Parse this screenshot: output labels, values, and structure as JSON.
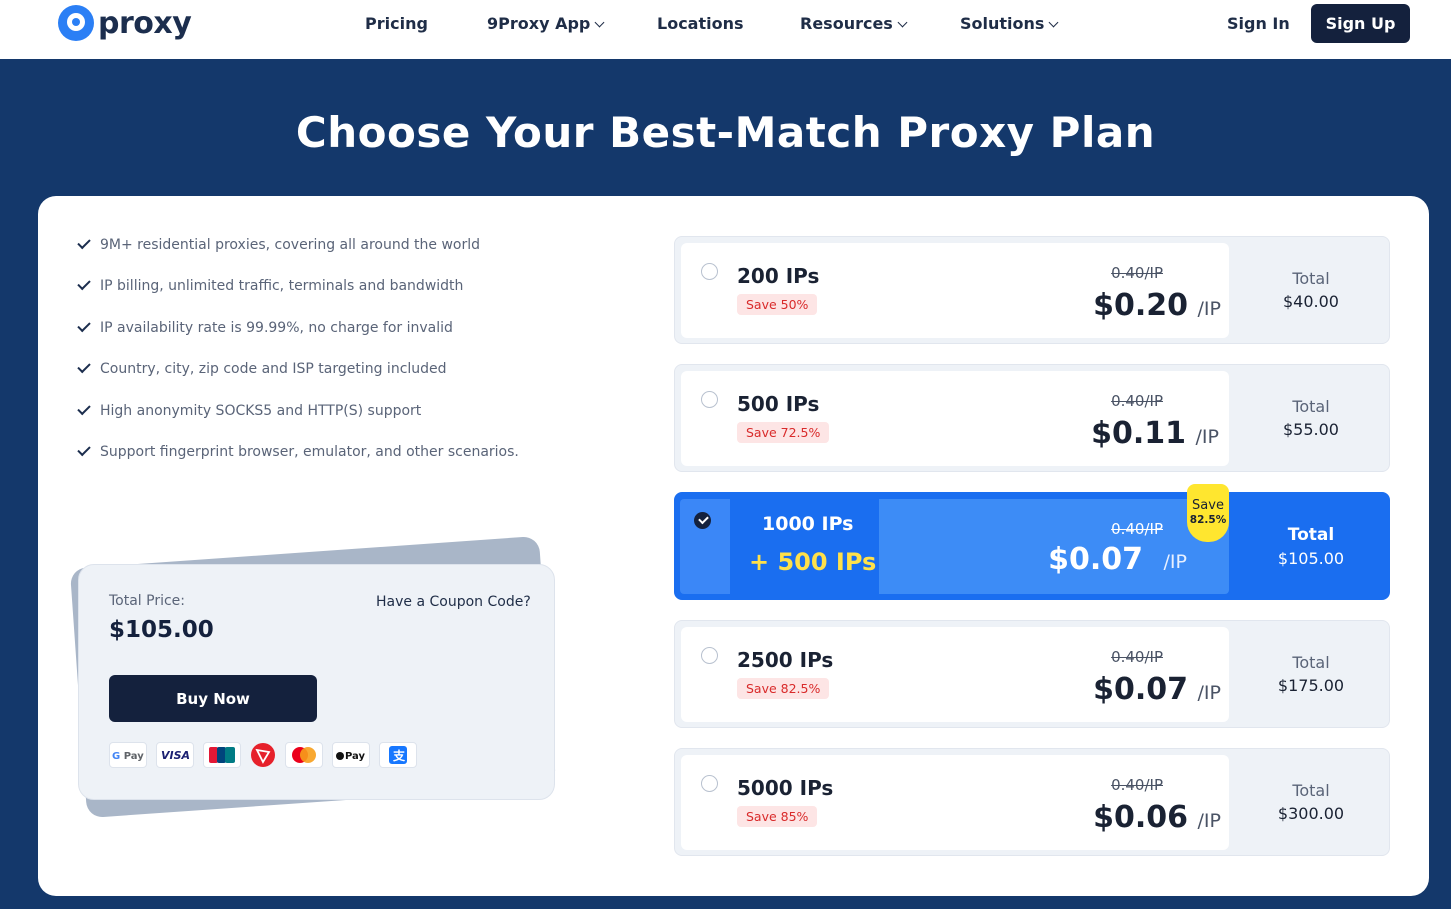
{
  "header": {
    "logo_text": "proxy",
    "nav": [
      "Pricing",
      "9Proxy App",
      "Locations",
      "Resources",
      "Solutions"
    ],
    "sign_in": "Sign In",
    "sign_up": "Sign Up"
  },
  "hero": {
    "title": "Choose Your Best-Match Proxy Plan"
  },
  "features": [
    "9M+ residential proxies, covering all around the world",
    "IP billing, unlimited traffic, terminals and bandwidth",
    "IP availability rate is 99.99%, no charge for invalid",
    "Country, city, zip code and ISP targeting included",
    "High anonymity SOCKS5 and HTTP(S) support",
    "Support fingerprint browser, emulator, and other scenarios."
  ],
  "purchase": {
    "total_label": "Total Price:",
    "total_value": "$105.00",
    "coupon": "Have a Coupon Code?",
    "buy_now": "Buy Now",
    "payments": [
      "G Pay",
      "VISA",
      "UnionPay",
      "TRON",
      "Mastercard",
      "Apple Pay",
      "Alipay"
    ]
  },
  "plans": [
    {
      "name": "200 IPs",
      "save": "Save 50%",
      "old_price": "0.40/IP",
      "price": "$0.20",
      "per": "/IP",
      "total_label": "Total",
      "total": "$40.00"
    },
    {
      "name": "500 IPs",
      "save": "Save 72.5%",
      "old_price": "0.40/IP",
      "price": "$0.11",
      "per": "/IP",
      "total_label": "Total",
      "total": "$55.00"
    },
    {
      "name": "1000 IPs",
      "bonus": "+ 500 IPs",
      "save_tag_1": "Save",
      "save_tag_2": "82.5%",
      "old_price": "0.40/IP",
      "price": "$0.07",
      "per": "/IP",
      "total_label": "Total",
      "total": "$105.00",
      "selected": true
    },
    {
      "name": "2500 IPs",
      "save": "Save 82.5%",
      "old_price": "0.40/IP",
      "price": "$0.07",
      "per": "/IP",
      "total_label": "Total",
      "total": "$175.00"
    },
    {
      "name": "5000 IPs",
      "save": "Save 85%",
      "old_price": "0.40/IP",
      "price": "$0.06",
      "per": "/IP",
      "total_label": "Total",
      "total": "$300.00"
    }
  ],
  "colors": {
    "background": "#14386b",
    "primary_dark": "#14213d",
    "selected_blue": "#1a6ef0",
    "bonus_yellow": "#ffe14a",
    "save_red": "#d92b2b"
  }
}
